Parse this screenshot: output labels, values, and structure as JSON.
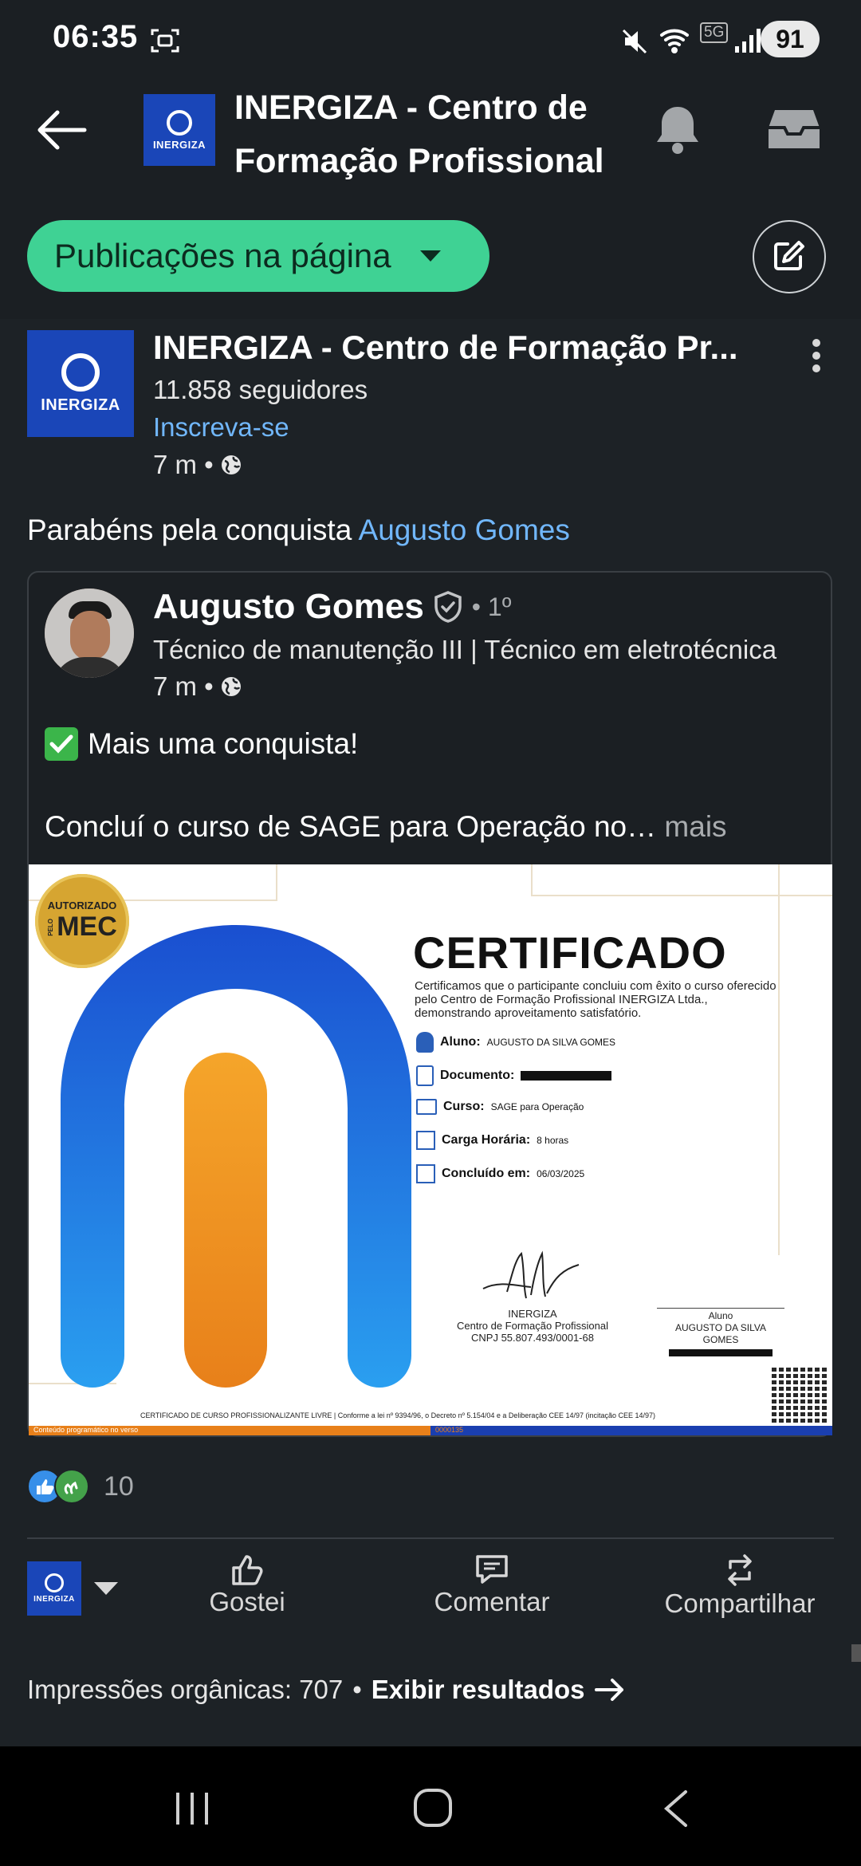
{
  "status_bar": {
    "time": "06:35",
    "network": "5G",
    "battery": "91"
  },
  "header": {
    "title": "INERGIZA - Centro de Formação Profissional",
    "logo_text": "INERGIZA"
  },
  "filter": {
    "label": "Publicações na página"
  },
  "post": {
    "page_name": "INERGIZA - Centro de Formação Pr...",
    "followers": "11.858 seguidores",
    "subscribe": "Inscreva-se",
    "time": "7 m •",
    "caption_prefix": "Parabéns pela conquista ",
    "caption_mention": "Augusto Gomes"
  },
  "shared": {
    "author": "Augusto Gomes",
    "degree": "• 1º",
    "headline": "Técnico de manutenção III | Técnico em eletrotécnica",
    "time": "7 m •",
    "line1": "Mais uma conquista!",
    "line2": "Concluí o curso de SAGE para Operação no…",
    "more": "mais"
  },
  "certificate": {
    "badge_top": "AUTORIZADO",
    "badge_side": "PELO",
    "badge_main": "MEC",
    "title": "CERTIFICADO",
    "intro": "Certificamos que o participante concluiu com êxito o curso oferecido pelo Centro de Formação Profissional INERGIZA Ltda., demonstrando aproveitamento satisfatório.",
    "aluno_label": "Aluno:",
    "aluno_value": "AUGUSTO DA SILVA GOMES",
    "documento_label": "Documento:",
    "curso_label": "Curso:",
    "curso_value": "SAGE para Operação",
    "carga_label": "Carga Horária:",
    "carga_value": "8 horas",
    "concluido_label": "Concluído em:",
    "concluido_value": "06/03/2025",
    "sig1_name": "INERGIZA",
    "sig1_line1": "Centro de Formação Profissional",
    "sig1_line2": "CNPJ 55.807.493/0001-68",
    "sig2_role": "Aluno",
    "sig2_name": "AUGUSTO DA SILVA GOMES",
    "footer": "CERTIFICADO DE CURSO PROFISSIONALIZANTE LIVRE | Conforme a lei nº 9394/96, o Decreto nº 5.154/04 e a Deliberação CEE 14/97 (incitação CEE 14/97)",
    "footer2": "Conteúdo programático no verso",
    "footer3": "0000135"
  },
  "reactions": {
    "count": "10"
  },
  "actions": {
    "like": "Gostei",
    "comment": "Comentar",
    "share": "Compartilhar"
  },
  "impressions": {
    "label": "Impressões orgânicas: 707",
    "separator": "•",
    "view_results": "Exibir resultados"
  },
  "colors": {
    "background": "#1b1f23",
    "accent_green": "#3fd294",
    "link_blue": "#71b7fb",
    "brand_blue": "#1a46b8"
  }
}
